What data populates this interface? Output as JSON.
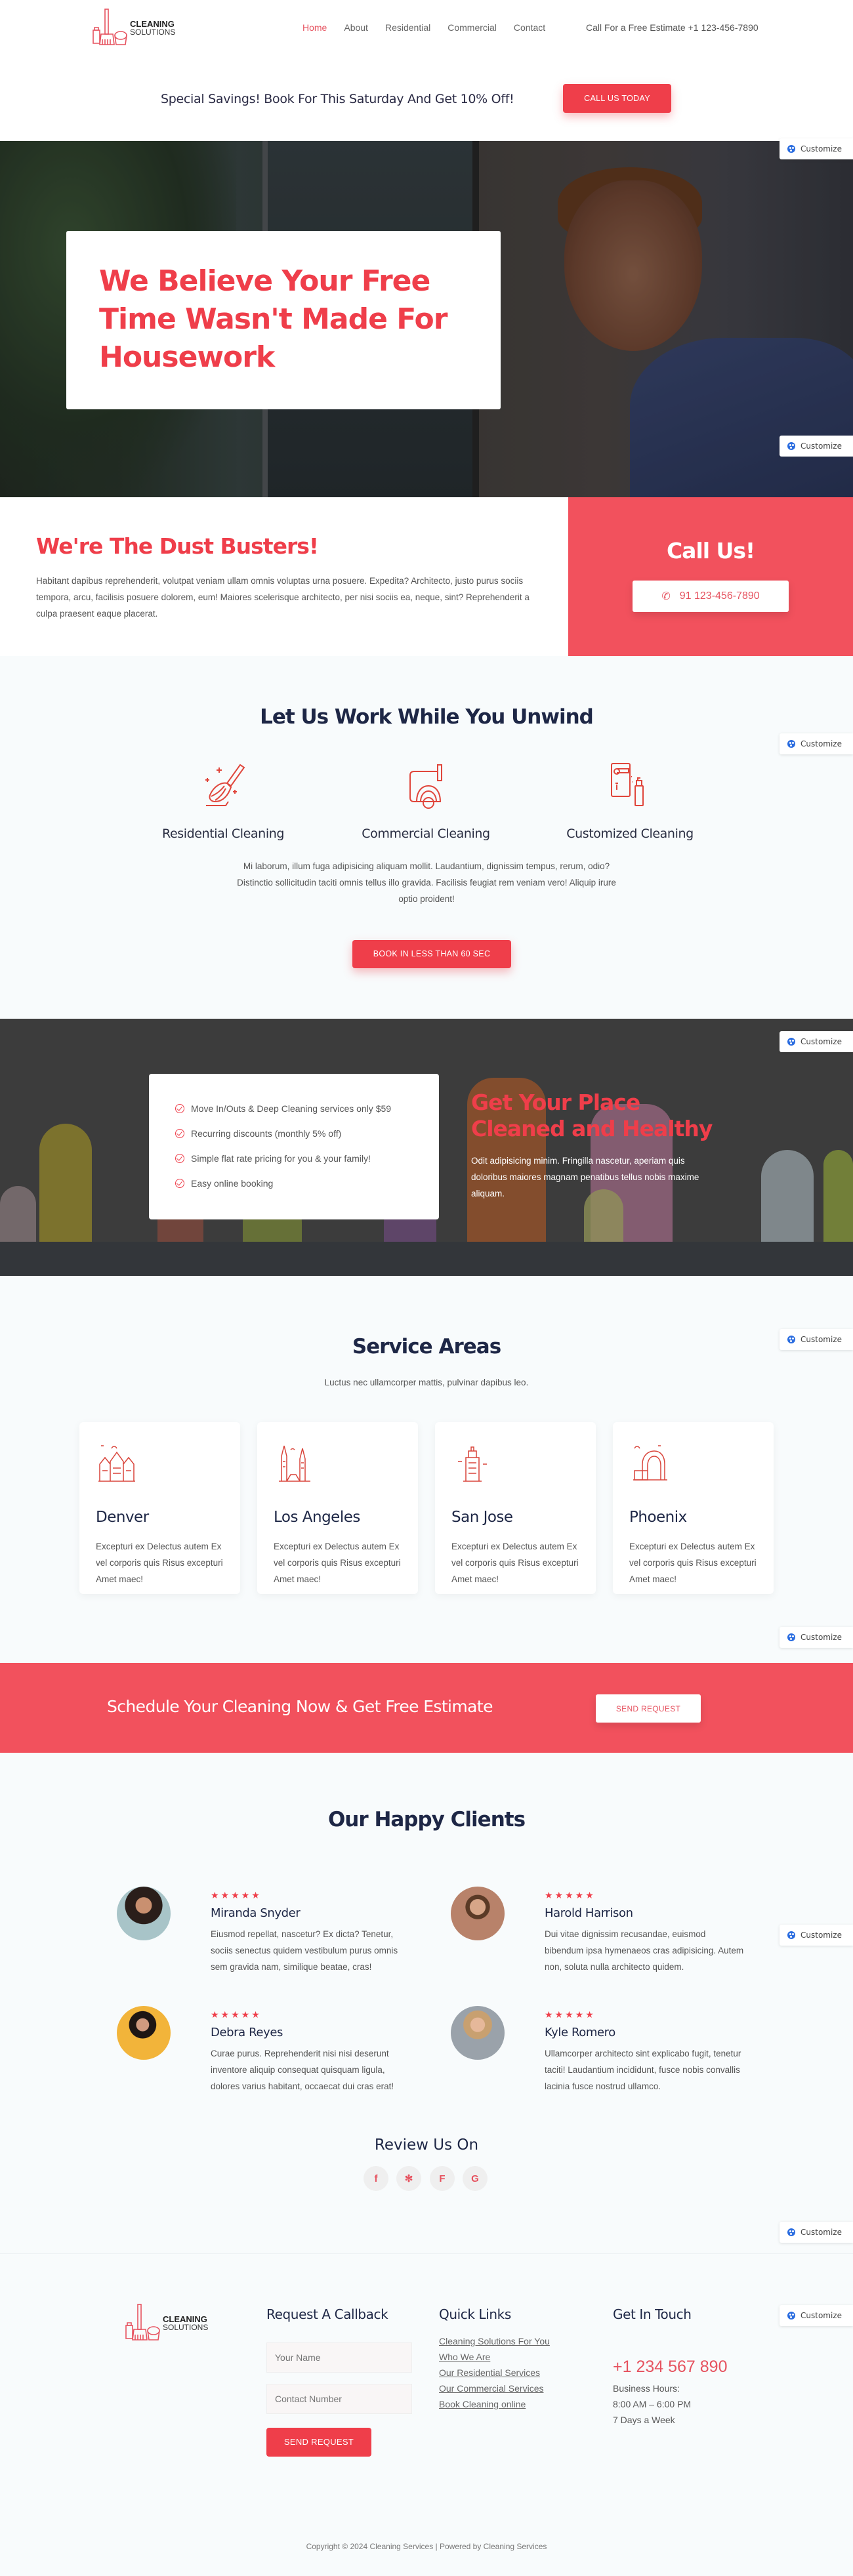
{
  "header": {
    "logo": {
      "line1": "CLEANING",
      "line2": "SOLUTIONS"
    },
    "nav": [
      {
        "label": "Home",
        "active": true
      },
      {
        "label": "About",
        "active": false
      },
      {
        "label": "Residential",
        "active": false
      },
      {
        "label": "Commercial",
        "active": false
      },
      {
        "label": "Contact",
        "active": false
      }
    ],
    "phone_text": "Call For a Free Estimate +1 123-456-7890",
    "promo_text": "Special Savings! Book For This Saturday And Get 10% Off!",
    "promo_button": "CALL US TODAY"
  },
  "hero": {
    "title": "We Believe Your Free Time Wasn't Made For Housework"
  },
  "customize_label": "Customize",
  "dust": {
    "title": "We're The Dust Busters!",
    "text": "Habitant dapibus reprehenderit, volutpat veniam ullam omnis voluptas urna posuere. Expedita? Architecto, justo purus sociis tempora, arcu, facilisis posuere dolorem, eum! Maiores scelerisque architecto, per nisi sociis ea, neque, sint? Reprehenderit a culpa praesent eaque placerat.",
    "callus_title": "Call Us!",
    "callus_phone": "91 123-456-7890"
  },
  "work": {
    "title": "Let Us Work While You Unwind",
    "services": [
      {
        "label": "Residential Cleaning",
        "icon": "broom-icon"
      },
      {
        "label": "Commercial Cleaning",
        "icon": "vacuum-icon"
      },
      {
        "label": "Customized Cleaning",
        "icon": "door-spray-icon"
      }
    ],
    "text": "Mi laborum, illum fuga adipisicing aliquam mollit. Laudantium, dignissim tempus, rerum, odio? Distinctio sollicitudin taciti omnis tellus illo gravida. Facilisis feugiat rem veniam vero! Aliquip irure optio proident!",
    "button": "BOOK IN LESS THAN 60 SEC"
  },
  "features": {
    "checklist": [
      "Move In/Outs & Deep Cleaning services only $59",
      "Recurring discounts (monthly 5% off)",
      "Simple flat rate pricing for you & your family!",
      "Easy online booking"
    ],
    "title": "Get Your Place Cleaned and Healthy",
    "text": "Odit adipisicing minim. Fringilla nascetur, aperiam quis doloribus maiores magnam penatibus tellus nobis maxime aliquam."
  },
  "areas": {
    "title": "Service Areas",
    "subtitle": "Luctus nec ullamcorper mattis, pulvinar dapibus leo.",
    "cards": [
      {
        "name": "Denver",
        "text": "Excepturi ex Delectus autem Ex vel corporis quis Risus excepturi Amet maec!"
      },
      {
        "name": "Los Angeles",
        "text": "Excepturi ex Delectus autem Ex vel corporis quis Risus excepturi Amet maec!"
      },
      {
        "name": "San Jose",
        "text": "Excepturi ex Delectus autem Ex vel corporis quis Risus excepturi Amet maec!"
      },
      {
        "name": "Phoenix",
        "text": "Excepturi ex Delectus autem Ex vel corporis quis Risus excepturi Amet maec!"
      }
    ]
  },
  "schedule": {
    "text": "Schedule Your Cleaning Now & Get Free Estimate",
    "button": "SEND REQUEST"
  },
  "clients": {
    "title": "Our Happy Clients",
    "stars": "★★★★★",
    "rating": 5,
    "testimonials": [
      {
        "name": "Miranda Snyder",
        "text": "Eiusmod repellat, nascetur? Ex dicta? Tenetur, sociis senectus quidem vestibulum purus omnis sem gravida nam, similique beatae, cras!"
      },
      {
        "name": "Harold Harrison",
        "text": "Dui vitae dignissim recusandae, euismod bibendum ipsa hymenaeos cras adipisicing. Autem non, soluta nulla architecto quidem."
      },
      {
        "name": "Debra Reyes",
        "text": "Curae purus. Reprehenderit nisi nisi deserunt inventore aliquip consequat quisquam ligula, dolores varius habitant, occaecat dui cras erat!"
      },
      {
        "name": "Kyle Romero",
        "text": "Ullamcorper architecto sint explicabo fugit, tenetur taciti! Laudantium incididunt, fusce nobis convallis lacinia fusce nostrud ullamco."
      }
    ],
    "review_title": "Review Us On",
    "social": [
      {
        "name": "facebook",
        "glyph": "f"
      },
      {
        "name": "yelp",
        "glyph": "✻"
      },
      {
        "name": "foursquare",
        "glyph": "F"
      },
      {
        "name": "google",
        "glyph": "G"
      }
    ]
  },
  "footer": {
    "callback_title": "Request A Callback",
    "name_placeholder": "Your Name",
    "number_placeholder": "Contact Number",
    "send_button": "SEND REQUEST",
    "links_title": "Quick Links",
    "links": [
      "Cleaning Solutions For You",
      "Who We Are",
      "Our Residential Services",
      "Our Commercial Services",
      "Book Cleaning online"
    ],
    "touch_title": "Get In Touch",
    "phone": "+1 234 567 890",
    "hours": [
      "Business Hours:",
      "8:00 AM – 6:00 PM",
      "7 Days a Week"
    ],
    "copyright": "Copyright © 2024 Cleaning Services | Powered by Cleaning Services"
  },
  "colors": {
    "accent": "#ef3e4a",
    "accent_panel": "#f2515d",
    "heading": "#1e2746",
    "customize_icon": "#2b6de0"
  }
}
